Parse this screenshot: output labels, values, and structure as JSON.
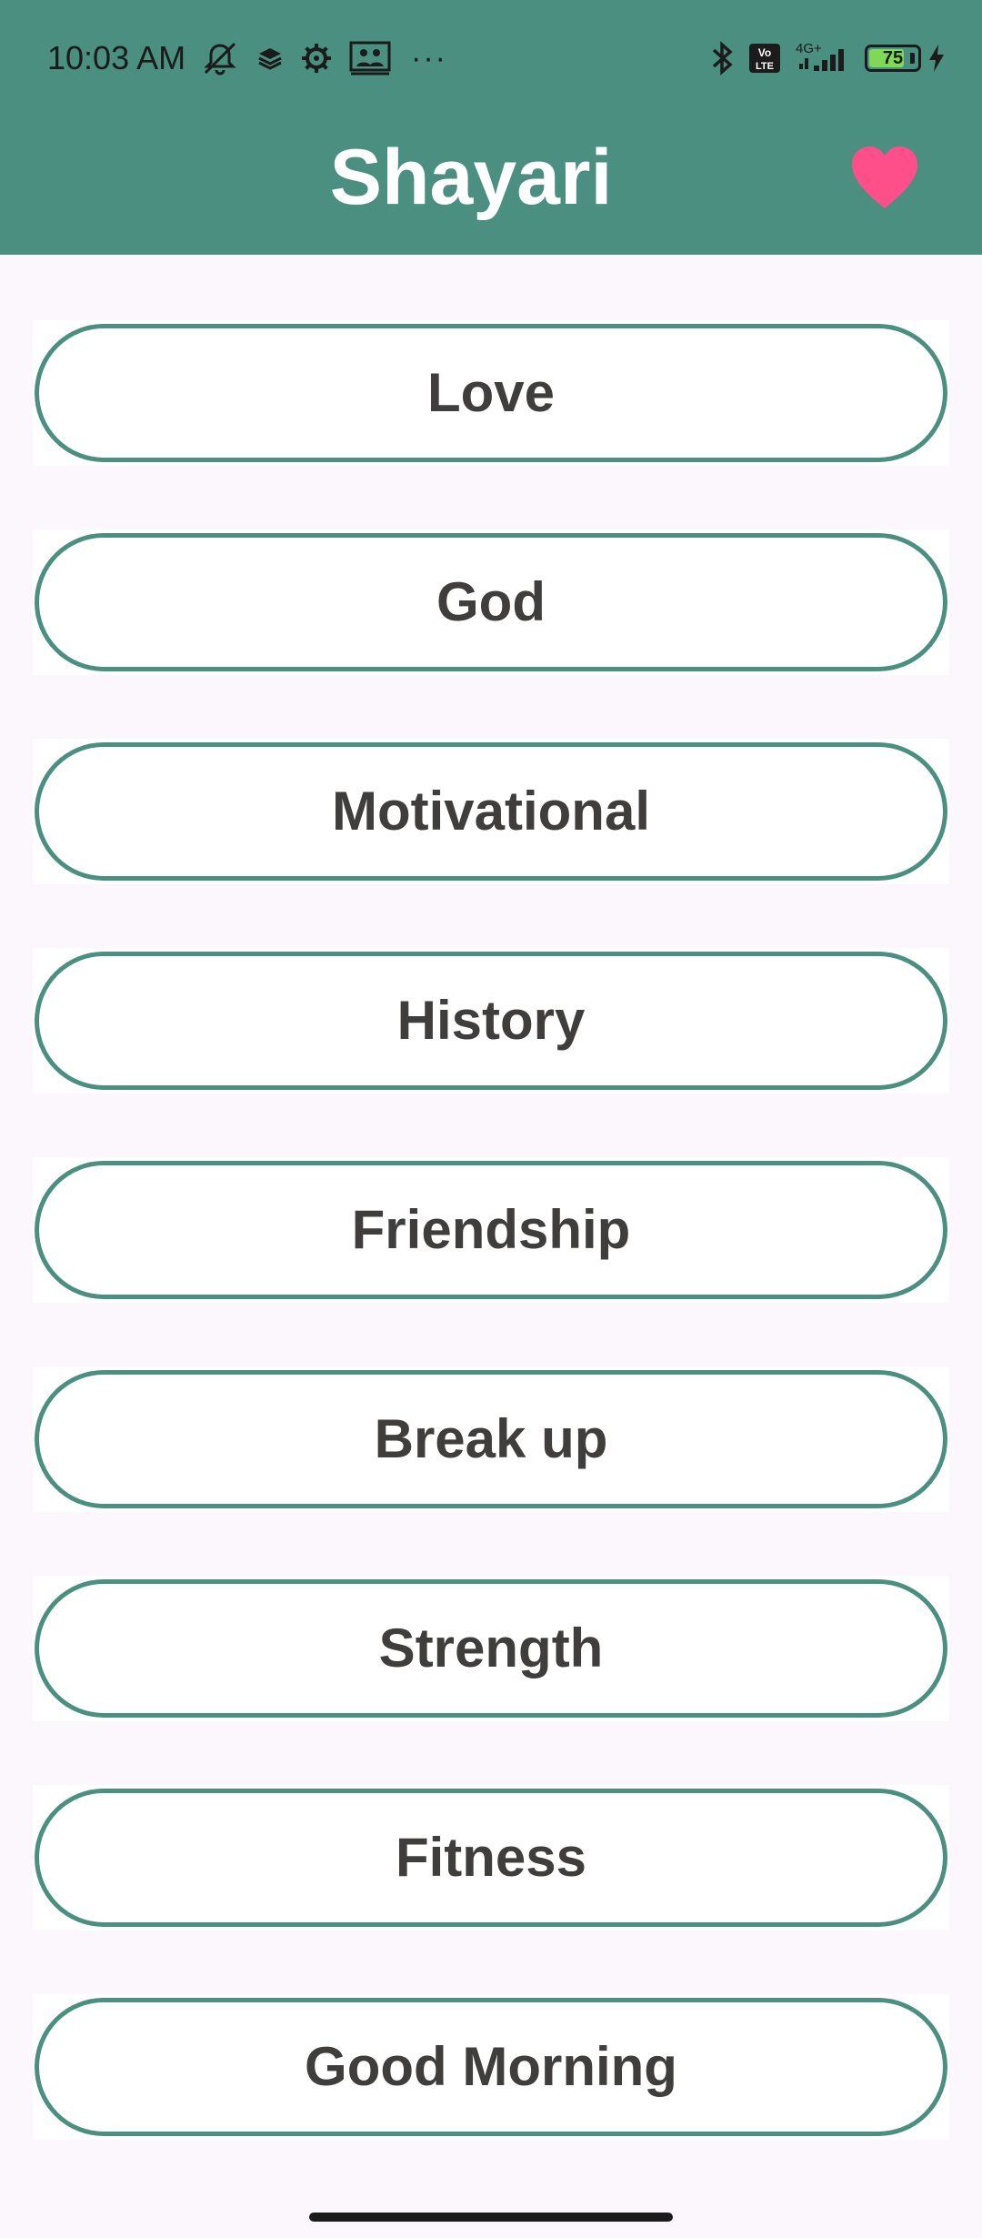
{
  "status_bar": {
    "time": "10:03 AM",
    "network": "4G+",
    "battery": "75",
    "battery_level": 0.75
  },
  "app_bar": {
    "title": "Shayari",
    "favorite_icon": "heart-icon",
    "favorite_color": "#ff4f8b",
    "background_color": "#4a8f80"
  },
  "categories": [
    {
      "label": "Love"
    },
    {
      "label": "God"
    },
    {
      "label": "Motivational"
    },
    {
      "label": "History"
    },
    {
      "label": "Friendship"
    },
    {
      "label": "Break up"
    },
    {
      "label": "Strength"
    },
    {
      "label": "Fitness"
    },
    {
      "label": "Good Morning"
    }
  ],
  "colors": {
    "accent": "#4a8f80",
    "button_text": "#3f3e3d",
    "page_background": "#fcf7fd"
  }
}
